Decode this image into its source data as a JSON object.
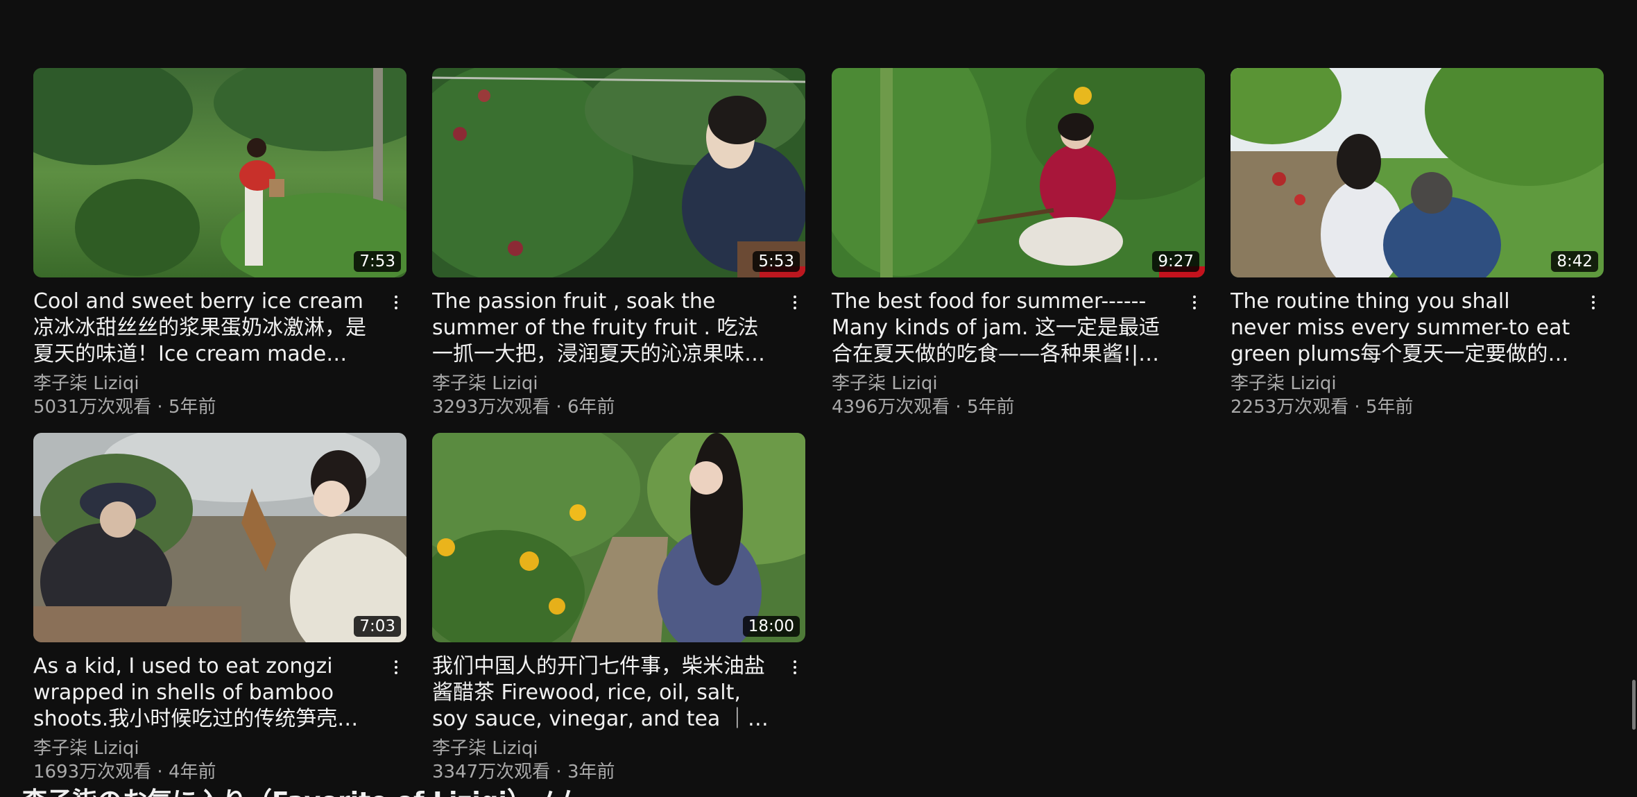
{
  "videos": [
    {
      "title": "Cool and sweet berry ice cream凉冰冰甜丝丝的浆果蛋奶冰激淋，是夏天的味道！Ice cream made fro…",
      "channel": "李子柒 Liziqi",
      "stats": "5031万次观看 · 5年前",
      "duration": "7:53"
    },
    {
      "title": "The passion fruit , soak the summer of the fruity fruit . 吃法一抓一大把，浸润夏天的沁凉果味…",
      "channel": "李子柒 Liziqi",
      "stats": "3293万次观看 · 6年前",
      "duration": "5:53"
    },
    {
      "title": "The best food for summer------Many kinds of jam. 这一定是最适合在夏天做的吃食——各种果酱!| Liz…",
      "channel": "李子柒 Liziqi",
      "stats": "4396万次观看 · 5年前",
      "duration": "9:27"
    },
    {
      "title": "The routine thing you shall never miss every summer-to eat green plums每个夏天一定要做的事情…",
      "channel": "李子柒 Liziqi",
      "stats": "2253万次观看 · 5年前",
      "duration": "8:42"
    },
    {
      "title": "As a kid, I used to eat zongzi wrapped in shells of bamboo shoots.我小时候吃过的传统笋壳…",
      "channel": "李子柒 Liziqi",
      "stats": "1693万次观看 · 4年前",
      "duration": "7:03"
    },
    {
      "title": "我们中国人的开门七件事，柴米油盐酱醋茶 Firewood, rice, oil, salt, soy sauce, vinegar, and tea ｜ Liz…",
      "channel": "李子柒 Liziqi",
      "stats": "3347万次观看 · 3年前",
      "duration": "18:00"
    }
  ],
  "next_section_title": "李子柒のお気に入り（Favorite of Liziqi）ノム",
  "icons": {
    "more_menu": "vertical-ellipsis-icon"
  },
  "colors": {
    "background": "#0f0f0f",
    "primary_text": "#f1f1f1",
    "secondary_text": "#aaaaaa",
    "duration_badge": "#000000"
  }
}
